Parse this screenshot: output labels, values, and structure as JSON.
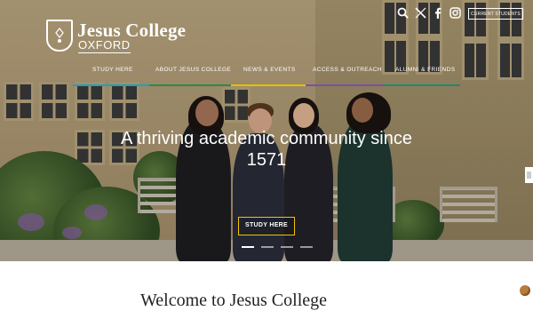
{
  "brand": {
    "line1": "Jesus College",
    "line2": "OXFORD",
    "crest_icon": "crest-icon"
  },
  "utility": {
    "current_students": "CURRENT STUDENTS",
    "icons": [
      "search-icon",
      "x-icon",
      "facebook-icon",
      "instagram-icon"
    ]
  },
  "nav": [
    {
      "label": "STUDY HERE",
      "color": "#1aa3b8"
    },
    {
      "label": "ABOUT JESUS COLLEGE",
      "color": "#2b8a4a"
    },
    {
      "label": "NEWS & EVENTS",
      "color": "#e2c200"
    },
    {
      "label": "ACCESS & OUTREACH",
      "color": "#7b4fa8"
    },
    {
      "label": "ALUMNI & FRIENDS",
      "color": "#1a8c6e"
    }
  ],
  "hero": {
    "headline": "A thriving academic community since 1571",
    "cta": "STUDY HERE",
    "slides": 4,
    "active_slide": 0,
    "accent": "#f1c400"
  },
  "welcome": {
    "heading": "Welcome to Jesus College"
  }
}
